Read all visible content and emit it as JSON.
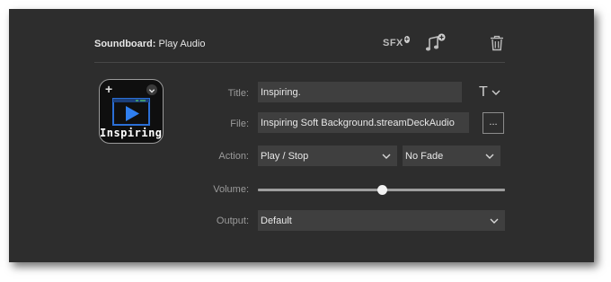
{
  "header": {
    "title_bold": "Soundboard:",
    "title_rest": "Play Audio",
    "sfx_label": "SFX"
  },
  "key_preview": {
    "title_text": "Inspiring."
  },
  "form": {
    "title": {
      "label": "Title:",
      "value": "Inspiring."
    },
    "file": {
      "label": "File:",
      "value": "Inspiring Soft Background.streamDeckAudio",
      "browse_label": "..."
    },
    "action": {
      "label": "Action:",
      "selected": "Play / Stop",
      "fade_selected": "No Fade"
    },
    "volume": {
      "label": "Volume:",
      "level_fraction": 0.5
    },
    "output": {
      "label": "Output:",
      "selected": "Default"
    }
  },
  "icons": {
    "add_sfx": "sfx-plus-icon",
    "add_music": "music-note-plus-icon",
    "delete": "trash-icon",
    "font": "text-format-icon",
    "chevron": "chevron-down-icon",
    "play": "play-icon"
  },
  "colors": {
    "panel_bg": "#2d2d2d",
    "field_bg": "#3f3f3f",
    "accent_blue": "#2b6fd6"
  }
}
